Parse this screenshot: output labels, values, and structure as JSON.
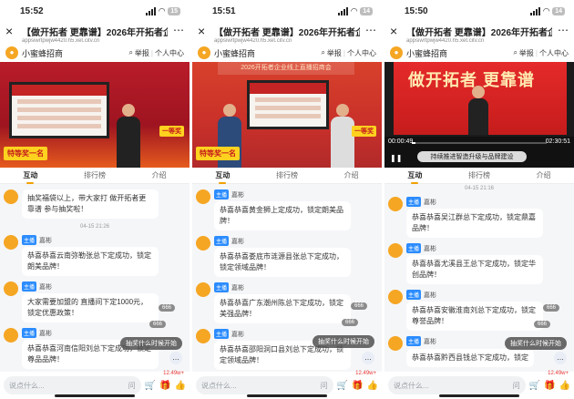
{
  "phones": [
    {
      "time": "15:52",
      "battery": "15",
      "page_title": "【做开拓者 更靠谱】2026年开拓者企业",
      "url": "appsiwrtpwjw4420.h5.xet.citv.cn",
      "host": "小蜜蜂招商",
      "report": "举报",
      "profile": "个人中心",
      "tabs": [
        "互动",
        "排行榜",
        "介绍"
      ],
      "video_banner": "",
      "promo": "特等奖一名",
      "badge": "一等奖",
      "messages": [
        {
          "name": "小蜜蜂招商",
          "tag": "",
          "text": "抽奖福袋以上，带大家打 做开拓者更靠谱 参与抽奖啦！"
        },
        {
          "time": "04-15 21:26"
        },
        {
          "name": "嘉彬",
          "tag": "主播",
          "text": "恭喜恭喜云南弥勒张总下定成功，锁定朗美品牌！"
        },
        {
          "name": "嘉彬",
          "tag": "主播",
          "text": "大家需要加盟的 直播间下定1000元，锁定优惠政策！"
        },
        {
          "name": "嘉彬",
          "tag": "主播",
          "text": "恭喜恭喜河南信阳刘总下定成功，锁定尊品品牌！"
        }
      ],
      "chips": [
        "666",
        "666"
      ],
      "pill": "抽奖什么时候开始",
      "say_placeholder": "说点什么...",
      "ask": "问",
      "likes": "12.49w+"
    },
    {
      "time": "15:51",
      "battery": "14",
      "page_title": "【做开拓者 更靠谱】2026年开拓者企业",
      "url": "appsiwrtpwjw4420.h5.xet.citv.cn",
      "host": "小蜜蜂招商",
      "report": "举报",
      "profile": "个人中心",
      "tabs": [
        "互动",
        "排行榜",
        "介绍"
      ],
      "video_banner": "2026开拓者企业线上直播招商会",
      "promo": "特等奖一名",
      "badge": "一等奖",
      "messages": [
        {
          "name": "嘉彬",
          "tag": "主播",
          "text": ""
        },
        {
          "name": "嘉彬",
          "tag": "主播",
          "text": "恭喜恭喜黄金狮上定成功，锁定朗美品牌！"
        },
        {
          "name": "嘉彬",
          "tag": "主播",
          "text": "恭喜恭喜娄底市涟源县张总下定成功，锁定领域品牌！"
        },
        {
          "name": "嘉彬",
          "tag": "主播",
          "text": "恭喜恭喜广东潮州陈总下定成功，锁定美强品牌！"
        },
        {
          "name": "嘉彬",
          "tag": "主播",
          "text": "恭喜恭喜邵阳洞口县刘总下定成功，锁定领域品牌！"
        }
      ],
      "chips": [
        "666",
        "666"
      ],
      "pill": "抽奖什么时候开始",
      "say_placeholder": "说点什么...",
      "ask": "问",
      "likes": "12.49w+"
    },
    {
      "time": "15:50",
      "battery": "14",
      "page_title": "【做开拓者 更靠谱】2026年开拓者企业",
      "url": "appsiwrtpwjw4420.h5.xet.citv.cn",
      "host": "小蜜蜂招商",
      "report": "举报",
      "profile": "个人中心",
      "tabs": [
        "互动",
        "排行榜",
        "介绍"
      ],
      "video_big": "做开拓者 更靠谱",
      "video_sub": "持续推进智造升级与品牌建设",
      "video_time_left": "00:00:49",
      "video_time_right": "02:30:51",
      "messages": [
        {
          "time": "04-15 21:16"
        },
        {
          "name": "嘉彬",
          "tag": "主播",
          "text": "恭喜恭喜吴江群总下定成功，锁定鼎嘉品牌！"
        },
        {
          "name": "嘉彬",
          "tag": "主播",
          "text": "恭喜恭喜尤溪县王总下定成功，锁定华创品牌！"
        },
        {
          "name": "嘉彬",
          "tag": "主播",
          "text": "恭喜恭喜安徽淮南刘总下定成功，锁定尊誉品牌！"
        },
        {
          "name": "嘉彬",
          "tag": "主播",
          "text": "恭喜恭喜黔西县钱总下定成功，锁定"
        }
      ],
      "chips": [
        "666",
        "666"
      ],
      "pill": "抽奖什么时候开始",
      "say_placeholder": "说点什么...",
      "ask": "问",
      "likes": "12.49w+"
    }
  ]
}
